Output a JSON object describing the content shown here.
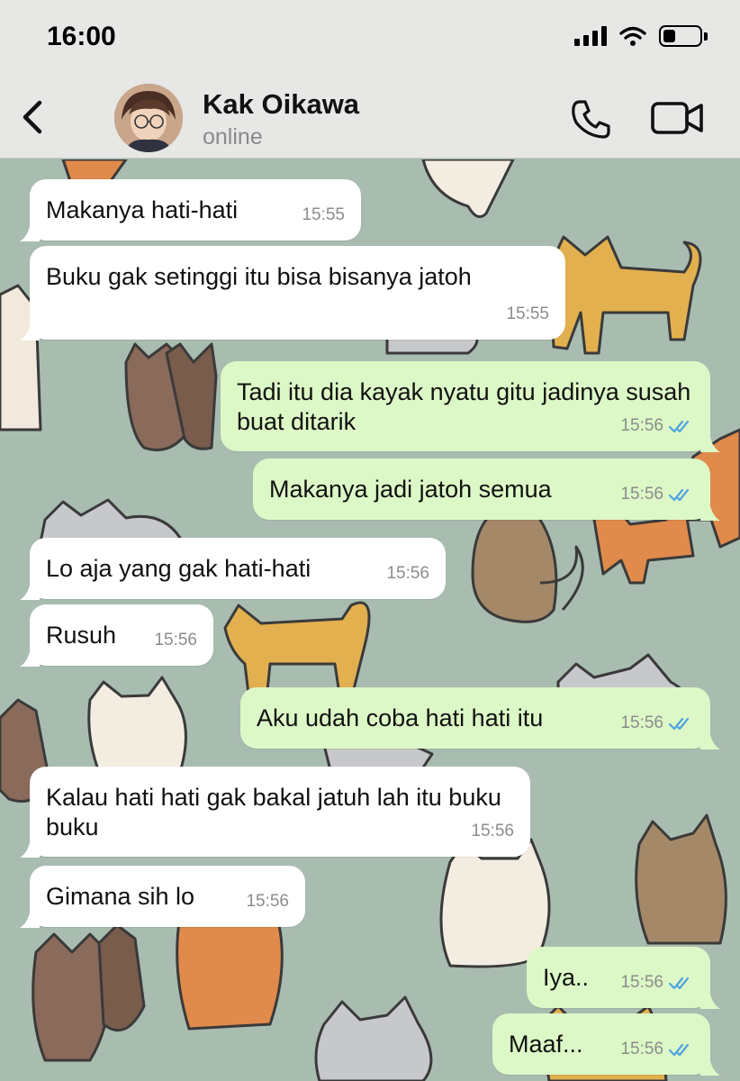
{
  "status_bar": {
    "time": "16:00",
    "battery_level": 0.35
  },
  "header": {
    "contact_name": "Kak Oikawa",
    "contact_status": "online"
  },
  "icons": {
    "back": "chevron-left-icon",
    "call": "phone-icon",
    "video": "video-camera-icon",
    "read": "double-check-icon"
  },
  "colors": {
    "incoming": "#ffffff",
    "outgoing": "#dcf8c6",
    "read_ticks": "#4fa3e0"
  },
  "messages": [
    {
      "dir": "in",
      "text": "Makanya hati-hati",
      "time": "15:55"
    },
    {
      "dir": "in",
      "text": "Buku gak setinggi itu bisa bisanya jatoh",
      "time": "15:55"
    },
    {
      "dir": "out",
      "text": "Tadi itu dia kayak nyatu gitu jadinya susah buat ditarik",
      "time": "15:56"
    },
    {
      "dir": "out",
      "text": "Makanya jadi jatoh semua",
      "time": "15:56"
    },
    {
      "dir": "in",
      "text": "Lo aja yang gak hati-hati",
      "time": "15:56"
    },
    {
      "dir": "in",
      "text": "Rusuh",
      "time": "15:56"
    },
    {
      "dir": "out",
      "text": "Aku udah coba hati hati itu",
      "time": "15:56"
    },
    {
      "dir": "in",
      "text": "Kalau hati hati gak bakal jatuh lah itu buku buku",
      "time": "15:56"
    },
    {
      "dir": "in",
      "text": "Gimana sih lo",
      "time": "15:56"
    },
    {
      "dir": "out",
      "text": "Iya..",
      "time": "15:56"
    },
    {
      "dir": "out",
      "text": "Maaf...",
      "time": "15:56"
    }
  ]
}
